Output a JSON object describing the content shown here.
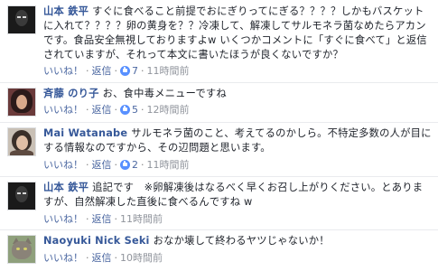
{
  "colors": {
    "author": "#365899",
    "link": "#4b67a1",
    "meta": "#90949c",
    "like_badge": "#5890ff",
    "divider": "#e9ebee"
  },
  "comments": [
    {
      "author": "山本 鉄平",
      "text": "すぐに食べること前提でおにぎりってにぎる？？？？しかもバスケットに入れて？？？？卵の黄身を？？冷凍して、解凍してサルモネラ菌なめたらアカンです。食品安全無視しておりますよw いくつかコメントに「すぐに食べて」と返信されていますが、それって本文に書いたほうが良くないですか？",
      "like_label": "いいね！",
      "reply_label": "返信",
      "like_count": "7",
      "time": "11時間前"
    },
    {
      "author": "斉藤 のり子",
      "text": "お、食中毒メニューですね",
      "like_label": "いいね！",
      "reply_label": "返信",
      "like_count": "5",
      "time": "12時間前"
    },
    {
      "author": "Mai Watanabe",
      "text": "サルモネラ菌のこと、考えてるのかしら。不特定多数の人が目にする情報なのですから、その辺問題と思います。",
      "like_label": "いいね！",
      "reply_label": "返信",
      "like_count": "2",
      "time": "11時間前"
    },
    {
      "author": "山本 鉄平",
      "text": "追記です　※卵解凍後はなるべく早くお召し上がりください。とありますが、自然解凍した直後に食べるんですね w",
      "like_label": "いいね！",
      "reply_label": "返信",
      "like_count": "",
      "time": "11時間前"
    },
    {
      "author": "Naoyuki Nick Seki",
      "text": "おなか壊して終わるヤツじゃないか！",
      "like_label": "いいね！",
      "reply_label": "返信",
      "like_count": "",
      "time": "10時間前"
    }
  ]
}
